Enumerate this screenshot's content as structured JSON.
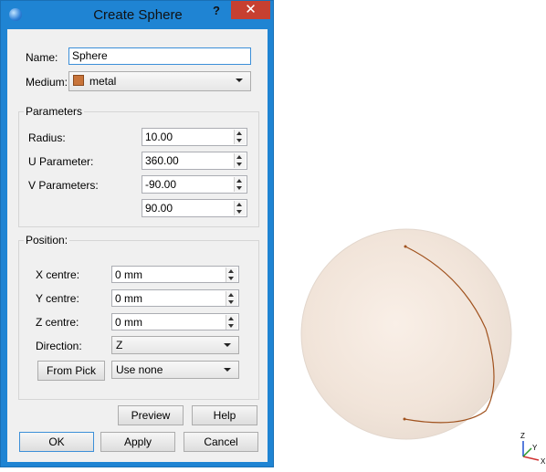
{
  "window": {
    "title": "Create Sphere",
    "help_label": "?",
    "close_label": "✕"
  },
  "form": {
    "name_label": "Name:",
    "name_value": "Sphere",
    "medium_label": "Medium:",
    "medium_value": "metal",
    "medium_icon": "material-cube-icon"
  },
  "parameters": {
    "title": "Parameters",
    "radius_label": "Radius:",
    "radius_value": "10.00",
    "u_label": "U Parameter:",
    "u_value": "360.00",
    "v_label": "V Parameters:",
    "v_min_value": "-90.00",
    "v_max_value": "90.00"
  },
  "position": {
    "title": "Position:",
    "x_label": "X centre:",
    "x_value": "0 mm",
    "y_label": "Y centre:",
    "y_value": "0 mm",
    "z_label": "Z centre:",
    "z_value": "0 mm",
    "direction_label": "Direction:",
    "direction_value": "Z",
    "from_pick_label": "From Pick",
    "pick_value": "Use none"
  },
  "buttons": {
    "preview": "Preview",
    "help": "Help",
    "ok": "OK",
    "apply": "Apply",
    "cancel": "Cancel"
  },
  "axes": {
    "z": "Z",
    "y": "Y",
    "x": "X"
  },
  "colors": {
    "title_bar": "#1f84d3",
    "close_button": "#c74030",
    "sphere_fill": "#f2e6dc",
    "sphere_curve": "#a0521e",
    "axis_x": "#d03030",
    "axis_y": "#2a9a2a",
    "axis_z": "#2050d0"
  }
}
